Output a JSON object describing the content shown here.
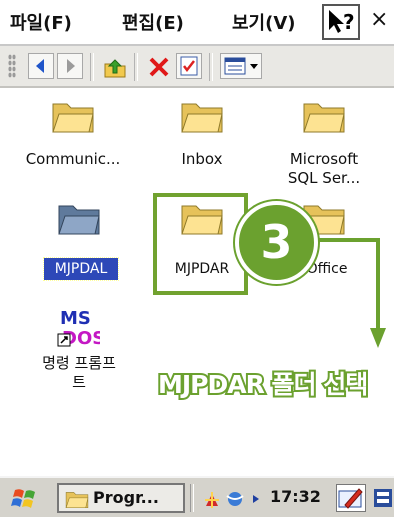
{
  "menubar": {
    "items": [
      "파일(F)",
      "편집(E)",
      "보기(V)"
    ],
    "help_label": "?",
    "close_label": "×"
  },
  "toolbar": {
    "buttons": [
      "back-icon",
      "forward-icon",
      "up-folder-icon",
      "delete-icon",
      "properties-icon",
      "view-menu-icon"
    ]
  },
  "items": [
    {
      "label": "Communic...",
      "icon": "folder-icon"
    },
    {
      "label": "Inbox",
      "icon": "folder-icon"
    },
    {
      "label": "Microsoft\nSQL Ser...",
      "icon": "folder-icon"
    },
    {
      "label": "MJPDAL",
      "icon": "folder-icon",
      "selected": true
    },
    {
      "label": "MJPDAR",
      "icon": "folder-icon"
    },
    {
      "label": "Office",
      "icon": "folder-icon"
    },
    {
      "label": "명령 프롬프\n트",
      "icon": "ms-dos-icon"
    }
  ],
  "annotation": {
    "step": "3",
    "text": "MJPDAR 폴더 선택",
    "color": "#6ba12f"
  },
  "taskbar": {
    "task_label": "Progr...",
    "time": "17:32"
  }
}
